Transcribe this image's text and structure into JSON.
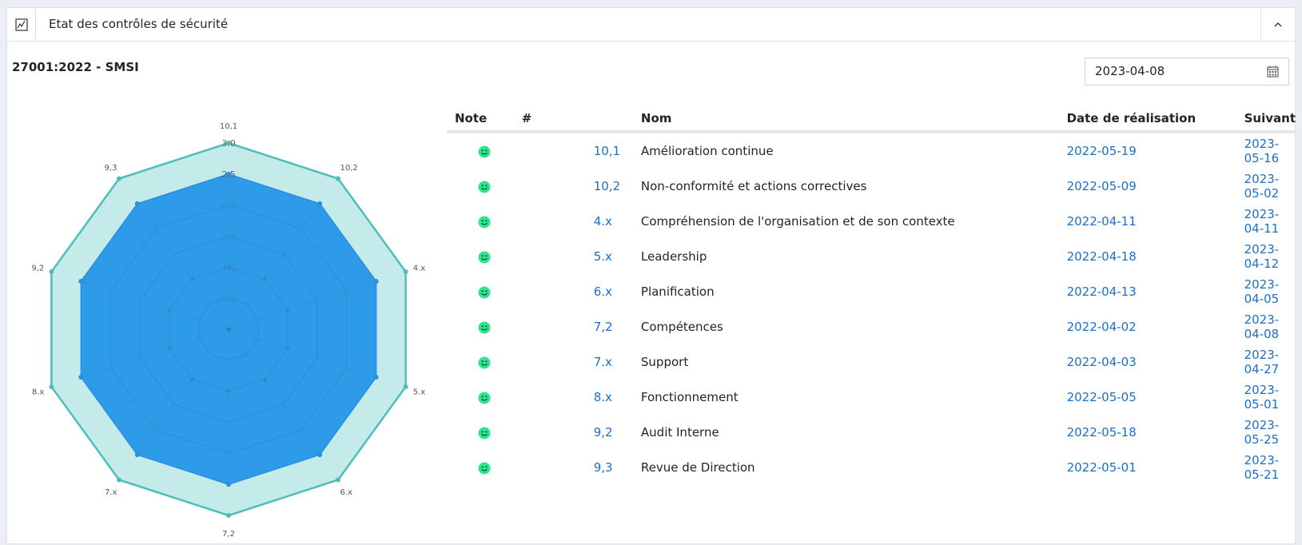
{
  "header": {
    "title": "Etat des contrôles de sécurité"
  },
  "section": {
    "title": "27001:2022 - SMSI"
  },
  "date_filter": {
    "value": "2023-04-08"
  },
  "colors": {
    "link": "#1a6fc9",
    "radar_fill": "#2d9be8",
    "radar_max_fill": "#c4eae9",
    "radar_max_stroke": "#4dbfba",
    "smiley": "#2ee58f"
  },
  "table": {
    "columns": {
      "note": "Note",
      "num": "#",
      "nom": "Nom",
      "date": "Date de réalisation",
      "next": "Suivant"
    },
    "rows": [
      {
        "status": "smiley-icon",
        "num": "10,1",
        "nom": "Amélioration continue",
        "date": "2022-05-19",
        "next": "2023-05-16"
      },
      {
        "status": "smiley-icon",
        "num": "10,2",
        "nom": "Non-conformité et actions correctives",
        "date": "2022-05-09",
        "next": "2023-05-02"
      },
      {
        "status": "smiley-icon",
        "num": "4.x",
        "nom": "Compréhension de l'organisation et de son contexte",
        "date": "2022-04-11",
        "next": "2023-04-11"
      },
      {
        "status": "smiley-icon",
        "num": "5.x",
        "nom": "Leadership",
        "date": "2022-04-18",
        "next": "2023-04-12"
      },
      {
        "status": "smiley-icon",
        "num": "6.x",
        "nom": "Planification",
        "date": "2022-04-13",
        "next": "2023-04-05"
      },
      {
        "status": "smiley-icon",
        "num": "7,2",
        "nom": "Compétences",
        "date": "2022-04-02",
        "next": "2023-04-08"
      },
      {
        "status": "smiley-icon",
        "num": "7.x",
        "nom": "Support",
        "date": "2022-04-03",
        "next": "2023-04-27"
      },
      {
        "status": "smiley-icon",
        "num": "8.x",
        "nom": "Fonctionnement",
        "date": "2022-05-05",
        "next": "2023-05-01"
      },
      {
        "status": "smiley-icon",
        "num": "9,2",
        "nom": "Audit Interne",
        "date": "2022-05-18",
        "next": "2023-05-25"
      },
      {
        "status": "smiley-icon",
        "num": "9,3",
        "nom": "Revue de Direction",
        "date": "2022-05-01",
        "next": "2023-05-21"
      }
    ]
  },
  "chart_data": {
    "type": "radar",
    "categories": [
      "10,1",
      "10,2",
      "4.x",
      "5.x",
      "6.x",
      "7.x",
      "8.x",
      "9,2",
      "9,3"
    ],
    "labels_display": [
      "10,1",
      "10,2",
      "4.x",
      "5.x",
      "6.x",
      "7,2",
      "7.x",
      "8.x",
      "9,2",
      "9,3"
    ],
    "scale_ticks": [
      "3.0",
      "2.5",
      "2.0",
      "1.5",
      "1.0",
      "0.5"
    ],
    "rmax": 3,
    "series": [
      {
        "values": [
          2.5,
          2.5,
          2.5,
          2.5,
          2.5,
          2.5,
          2.5,
          2.5,
          2.5,
          2.5
        ]
      },
      {
        "values": [
          3,
          3,
          3,
          3,
          3,
          3,
          3,
          3,
          3,
          3
        ]
      }
    ]
  }
}
